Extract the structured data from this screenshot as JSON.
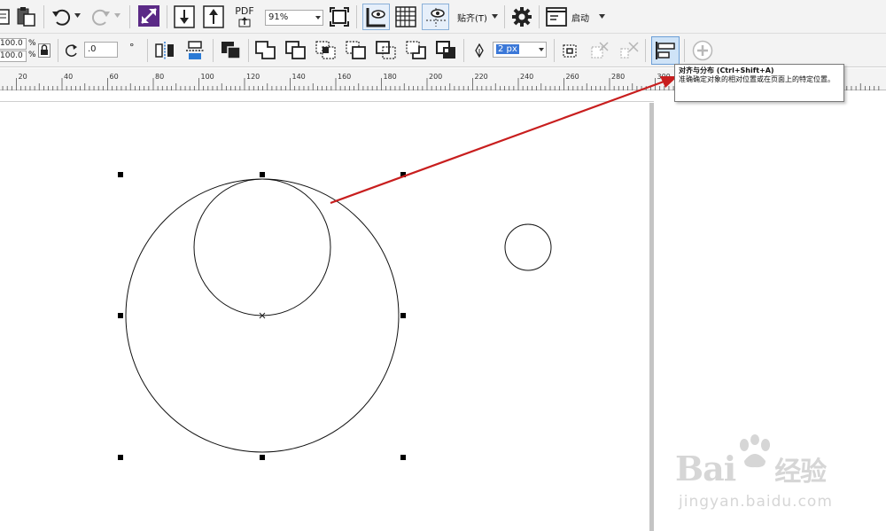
{
  "toolbar1": {
    "zoom": {
      "value": "91%"
    },
    "pdf_label": "PDF",
    "snap_label": "贴齐(T)",
    "launch_label": "启动"
  },
  "toolbar2": {
    "scale_x": "100.0",
    "scale_y": "100.0",
    "percent_x": "%",
    "percent_y": "%",
    "rotation": ".0",
    "degree": "°",
    "outline_width": "2 px"
  },
  "ruler": {
    "ticks": [
      "20",
      "40",
      "60",
      "80",
      "100",
      "120",
      "140",
      "160",
      "180",
      "200",
      "220",
      "240",
      "260",
      "280",
      "300"
    ]
  },
  "tooltip": {
    "title": "对齐与分布 (Ctrl+Shift+A)",
    "body": "准确确定对象的相对位置或在页面上的特定位置。"
  },
  "watermark": {
    "brand": "Bai",
    "brand_suffix": "经验",
    "url": "jingyan.baidu.com"
  },
  "colors": {
    "accent_purple": "#5b2a86",
    "arrow_red": "#c81e1e",
    "toolbar_bg": "#f3f3f3",
    "highlight_blue": "#cfe3f7"
  }
}
